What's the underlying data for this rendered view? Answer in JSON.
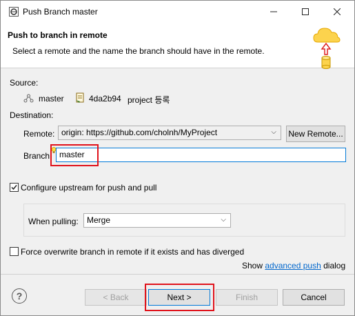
{
  "window": {
    "title": "Push Branch master"
  },
  "header": {
    "title": "Push to branch in remote",
    "description": "Select a remote and the name the branch should have in the remote."
  },
  "source": {
    "label": "Source:",
    "branch": "master",
    "commit_id": "4da2b94",
    "commit_message": "project 등록"
  },
  "destination": {
    "label": "Destination:",
    "remote_label": "Remote:",
    "remote_value": "origin: https://github.com/cholnh/MyProject",
    "new_remote_button": "New Remote...",
    "branch_label": "Branch:",
    "branch_value": "master"
  },
  "upstream": {
    "checkbox_label": "Configure upstream for push and pull",
    "checked": true,
    "when_pulling_label": "When pulling:",
    "when_pulling_value": "Merge"
  },
  "force": {
    "checkbox_label": "Force overwrite branch in remote if it exists and has diverged",
    "checked": false
  },
  "advanced": {
    "prefix": "Show ",
    "link": "advanced push",
    "suffix": " dialog"
  },
  "footer": {
    "back": "< Back",
    "next": "Next >",
    "finish": "Finish",
    "cancel": "Cancel"
  },
  "colors": {
    "highlight": "#e0111a",
    "focus": "#0078d7",
    "link": "#0066cc"
  }
}
